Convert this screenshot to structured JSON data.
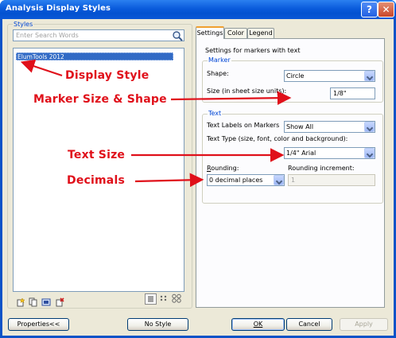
{
  "window": {
    "title": "Analysis Display Styles",
    "help_glyph": "?",
    "close_glyph": "✕"
  },
  "styles": {
    "group_label": "Styles",
    "search_placeholder": "Enter Search Words",
    "items": [
      {
        "label": "ElumTools 2012",
        "selected": true
      }
    ],
    "bottom_icons": [
      "new-style-icon",
      "duplicate-style-icon",
      "rename-style-icon",
      "delete-style-icon"
    ],
    "view_icons": [
      "list-view-icon",
      "small-icons-view-icon",
      "large-icons-view-icon"
    ]
  },
  "tabs": [
    {
      "label": "Settings",
      "active": true
    },
    {
      "label": "Color",
      "active": false
    },
    {
      "label": "Legend",
      "active": false
    }
  ],
  "settings": {
    "heading": "Settings for markers with text",
    "marker": {
      "group_label": "Marker",
      "shape_label": "Shape:",
      "shape_value": "Circle",
      "size_label": "Size (in sheet size units):",
      "size_value": "1/8\""
    },
    "text": {
      "group_label": "Text",
      "labels_label": "Text Labels on Markers",
      "labels_value": "Show All",
      "type_label": "Text Type (size, font, color and background):",
      "type_value": "1/4\" Arial",
      "rounding_label": "Rounding:",
      "rounding_value": "0 decimal places",
      "increment_label": "Rounding increment:",
      "increment_value": "1"
    }
  },
  "buttons": {
    "properties": "Properties<<",
    "no_style": "No Style",
    "ok": "OK",
    "cancel": "Cancel",
    "apply": "Apply"
  },
  "annotations": {
    "display_style": "Display Style",
    "marker_size_shape": "Marker Size & Shape",
    "text_size": "Text Size",
    "decimals": "Decimals"
  },
  "colors": {
    "annotation_red": "#e0101a",
    "selection_blue": "#316ac5",
    "title_blue": "#0a5bdc",
    "group_label_blue": "#0046d5"
  }
}
